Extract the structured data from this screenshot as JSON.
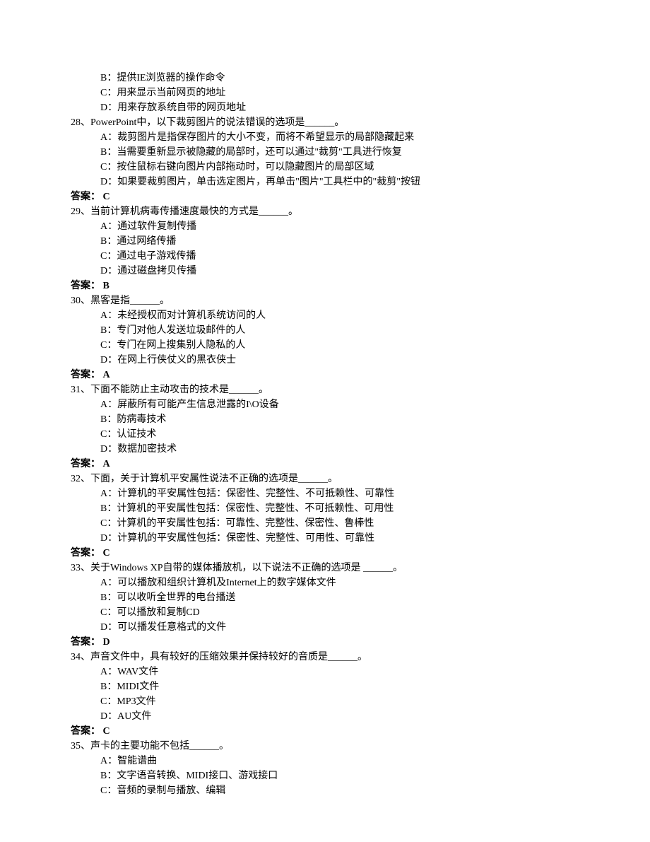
{
  "lines": [
    {
      "cls": "option",
      "text": "B：提供IE浏览器的操作命令"
    },
    {
      "cls": "option",
      "text": "C：用来显示当前网页的地址"
    },
    {
      "cls": "option",
      "text": "D：用来存放系统自带的网页地址"
    },
    {
      "cls": "question",
      "text": "28、PowerPoint中，以下裁剪图片的说法错误的选项是______。"
    },
    {
      "cls": "option",
      "text": "A：裁剪图片是指保存图片的大小不变，而将不希望显示的局部隐藏起来"
    },
    {
      "cls": "option",
      "text": "B：当需要重新显示被隐藏的局部时，还可以通过\"裁剪\"工具进行恢复"
    },
    {
      "cls": "option",
      "text": "C：按住鼠标右键向图片内部拖动时，可以隐藏图片的局部区域"
    },
    {
      "cls": "option",
      "text": "D：如果要裁剪图片，单击选定图片，再单击\"图片\"工具栏中的\"裁剪\"按钮"
    },
    {
      "cls": "answer",
      "text": "答案： C"
    },
    {
      "cls": "question",
      "text": "29、当前计算机病毒传播速度最快的方式是______。"
    },
    {
      "cls": "option",
      "text": "A：通过软件复制传播"
    },
    {
      "cls": "option",
      "text": "B：通过网络传播"
    },
    {
      "cls": "option",
      "text": "C：通过电子游戏传播"
    },
    {
      "cls": "option",
      "text": "D：通过磁盘拷贝传播"
    },
    {
      "cls": "answer",
      "text": "答案： B"
    },
    {
      "cls": "question",
      "text": "30、黑客是指______。"
    },
    {
      "cls": "option",
      "text": "A：未经授权而对计算机系统访问的人"
    },
    {
      "cls": "option",
      "text": "B：专门对他人发送垃圾邮件的人"
    },
    {
      "cls": "option",
      "text": "C：专门在网上搜集别人隐私的人"
    },
    {
      "cls": "option",
      "text": "D：在网上行侠仗义的黑衣侠士"
    },
    {
      "cls": "answer",
      "text": "答案： A"
    },
    {
      "cls": "question",
      "text": "31、下面不能防止主动攻击的技术是______。"
    },
    {
      "cls": "option",
      "text": "A：屏蔽所有可能产生信息泄露的I\\O设备"
    },
    {
      "cls": "option",
      "text": "B：防病毒技术"
    },
    {
      "cls": "option",
      "text": "C：认证技术"
    },
    {
      "cls": "option",
      "text": "D：数据加密技术"
    },
    {
      "cls": "answer",
      "text": "答案： A"
    },
    {
      "cls": "question",
      "text": "32、下面，关于计算机平安属性说法不正确的选项是______。"
    },
    {
      "cls": "option",
      "text": "A：计算机的平安属性包括：保密性、完整性、不可抵赖性、可靠性"
    },
    {
      "cls": "option",
      "text": "B：计算机的平安属性包括：保密性、完整性、不可抵赖性、可用性"
    },
    {
      "cls": "option",
      "text": "C：计算机的平安属性包括：可靠性、完整性、保密性、鲁棒性"
    },
    {
      "cls": "option",
      "text": "D：计算机的平安属性包括：保密性、完整性、可用性、可靠性"
    },
    {
      "cls": "answer",
      "text": "答案： C"
    },
    {
      "cls": "question",
      "text": "33、关于Windows XP自带的媒体播放机，以下说法不正确的选项是 ______。"
    },
    {
      "cls": "option",
      "text": "A：可以播放和组织计算机及Internet上的数字媒体文件"
    },
    {
      "cls": "option",
      "text": "B：可以收听全世界的电台播送"
    },
    {
      "cls": "option",
      "text": "C：可以播放和复制CD"
    },
    {
      "cls": "option",
      "text": "D：可以播发任意格式的文件"
    },
    {
      "cls": "answer",
      "text": "答案： D"
    },
    {
      "cls": "question",
      "text": "34、声音文件中，具有较好的压缩效果并保持较好的音质是______。"
    },
    {
      "cls": "option",
      "text": "A：WAV文件"
    },
    {
      "cls": "option",
      "text": "B：MIDI文件"
    },
    {
      "cls": "option",
      "text": "C：MP3文件"
    },
    {
      "cls": "option",
      "text": "D：AU文件"
    },
    {
      "cls": "answer",
      "text": "答案： C"
    },
    {
      "cls": "question",
      "text": "35、声卡的主要功能不包括______。"
    },
    {
      "cls": "option",
      "text": "A：智能谱曲"
    },
    {
      "cls": "option",
      "text": "B：文字语音转换、MIDI接口、游戏接口"
    },
    {
      "cls": "option",
      "text": "C：音频的录制与播放、编辑"
    }
  ]
}
